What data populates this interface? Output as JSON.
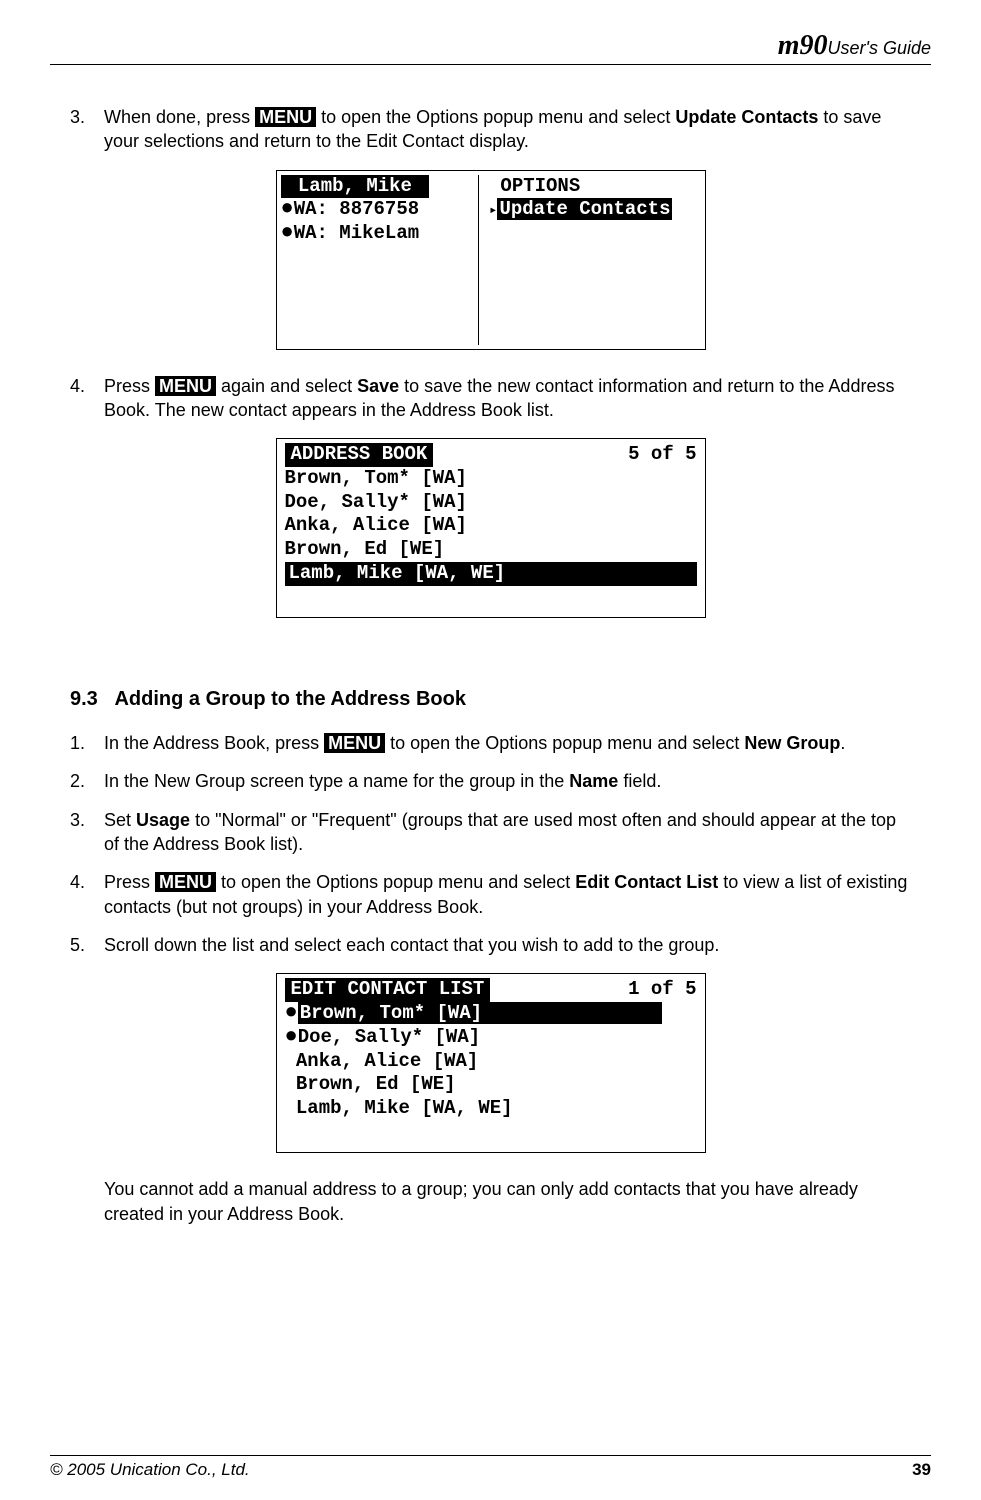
{
  "header": {
    "logo": "m90",
    "subtitle": "User's Guide"
  },
  "footer": {
    "copyright": "© 2005 Unication Co., Ltd.",
    "page": "39"
  },
  "step3": {
    "num": "3.",
    "pre": "When done, press ",
    "menu": "MENU",
    "mid": " to open the Options popup menu and select ",
    "bold1": "Update Contacts",
    "post": " to save your selections and return to the Edit Contact display."
  },
  "screen1": {
    "left_title": " Lamb, Mike ",
    "left_row1": "WA: 8876758",
    "left_row2": "WA: MikeLam",
    "right_title": " OPTIONS",
    "right_opt": "Update Contacts"
  },
  "step4": {
    "num": "4.",
    "pre": "Press ",
    "menu": "MENU",
    "mid": " again and select ",
    "bold1": "Save",
    "post": " to save the new contact information and return to the Address Book. The new contact appears in the Address Book list."
  },
  "screen2": {
    "title": " ADDRESS BOOK ",
    "counter": "5 of 5",
    "rows": [
      "Brown, Tom* [WA]",
      "Doe, Sally* [WA]",
      "Anka, Alice [WA]",
      "Brown, Ed [WE]"
    ],
    "selected": "Lamb, Mike [WA, WE]"
  },
  "section": {
    "num": "9.3",
    "title": "Adding a Group to the Address Book"
  },
  "s1": {
    "num": "1.",
    "pre": "In the Address Book, press ",
    "menu": "MENU",
    "mid": " to open the Options popup menu and select ",
    "bold1": "New Group",
    "post": "."
  },
  "s2": {
    "num": "2.",
    "pre": "In the New Group screen type a name for the group in the ",
    "bold1": "Name",
    "post": " field."
  },
  "s3": {
    "num": "3.",
    "pre": "Set ",
    "bold1": "Usage",
    "post": " to \"Normal\" or \"Frequent\" (groups that are used most often and should appear at the top of the Address Book list)."
  },
  "s4": {
    "num": "4.",
    "pre": "Press ",
    "menu": "MENU",
    "mid": " to open the Options popup menu and select ",
    "bold1": "Edit Contact List",
    "post": " to view a list of existing contacts (but not groups) in your Address Book."
  },
  "s5": {
    "num": "5.",
    "text": "Scroll down the list and select each contact that you wish to add to the group."
  },
  "screen3": {
    "title": " EDIT CONTACT LIST ",
    "counter": "1 of 5",
    "selected": "Brown, Tom* [WA]",
    "bullet_rows": [
      "Doe, Sally* [WA]"
    ],
    "plain_rows": [
      " Anka, Alice [WA]",
      " Brown, Ed [WE]",
      " Lamb, Mike [WA, WE]"
    ]
  },
  "note_text": "You cannot add a manual address to a group; you can only add contacts that you have already created in your Address Book."
}
